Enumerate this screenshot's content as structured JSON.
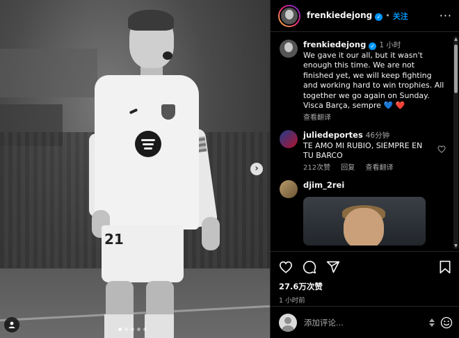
{
  "post": {
    "player_number": "21",
    "carousel_dot_count": 5,
    "carousel_active_index": 0
  },
  "header": {
    "username": "frenkiedejong",
    "verified_mark": "✓",
    "separator": "•",
    "follow_label": "关注",
    "more_label": "···"
  },
  "caption": {
    "username": "frenkiedejong",
    "time": "1 小时",
    "text": "We gave it our all, but it wasn't enough this time. We are not finished yet, we will keep fighting and working hard to win trophies. All together we go again on Sunday. Visca Barça, sempre",
    "heart_blue": "💙",
    "heart_red": "❤️",
    "translate_label": "查看翻译"
  },
  "comments": [
    {
      "username": "juliedeportes",
      "time": "46分钟",
      "text": "TE AMO MI RUBIO, SIEMPRE EN TU BARCO",
      "likes": "212次赞",
      "reply_label": "回复",
      "translate_label": "查看翻译",
      "like_icon": "heart-outline"
    },
    {
      "username": "djim_2rei",
      "has_media": true
    }
  ],
  "actions": {
    "icons": [
      "heart-outline",
      "comment-bubble",
      "share-paper-plane",
      "bookmark"
    ],
    "likes_count": "27.6万次赞",
    "posted_time": "1 小时前"
  },
  "composer": {
    "placeholder": "添加评论...",
    "emoji_icon": "smiley"
  },
  "colors": {
    "accent_blue": "#0095f6",
    "background": "#000000",
    "muted_text": "#a8a8a8",
    "divider": "#262626"
  }
}
